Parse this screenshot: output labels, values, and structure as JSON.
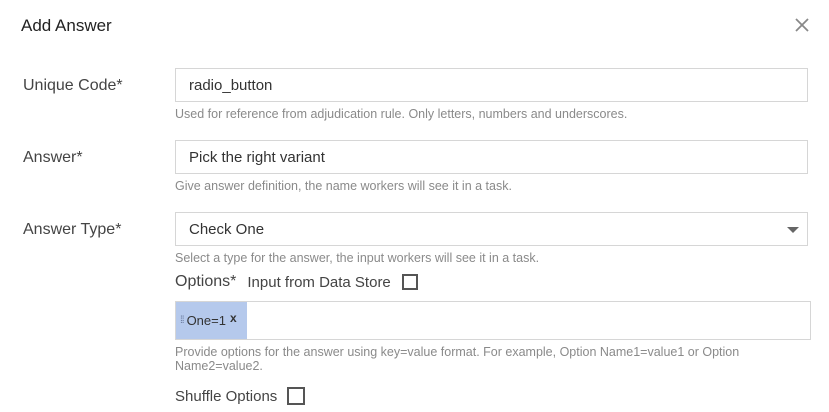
{
  "dialog": {
    "title": "Add Answer",
    "close_icon": "close-icon"
  },
  "unique_code": {
    "label": "Unique Code*",
    "value": "radio_button",
    "help": "Used for reference from adjudication rule. Only letters, numbers and underscores."
  },
  "answer": {
    "label": "Answer*",
    "value": "Pick the right variant",
    "help": "Give answer definition, the name workers will see it in a task."
  },
  "answer_type": {
    "label": "Answer Type*",
    "selected": "Check One",
    "help": "Select a type for the answer, the input workers will see it in a task."
  },
  "options": {
    "label": "Options*",
    "data_store_label": "Input from Data Store",
    "data_store_checked": false,
    "tags": [
      {
        "text": "One=1",
        "remove": "x"
      }
    ],
    "help": "Provide options for the answer using key=value format. For example, Option Name1=value1 or Option Name2=value2."
  },
  "shuffle": {
    "label": "Shuffle Options",
    "checked": false
  },
  "colors": {
    "tag_background": "#b5c9ec",
    "border": "#d6d6d6",
    "help_text": "#8a8a8a"
  }
}
